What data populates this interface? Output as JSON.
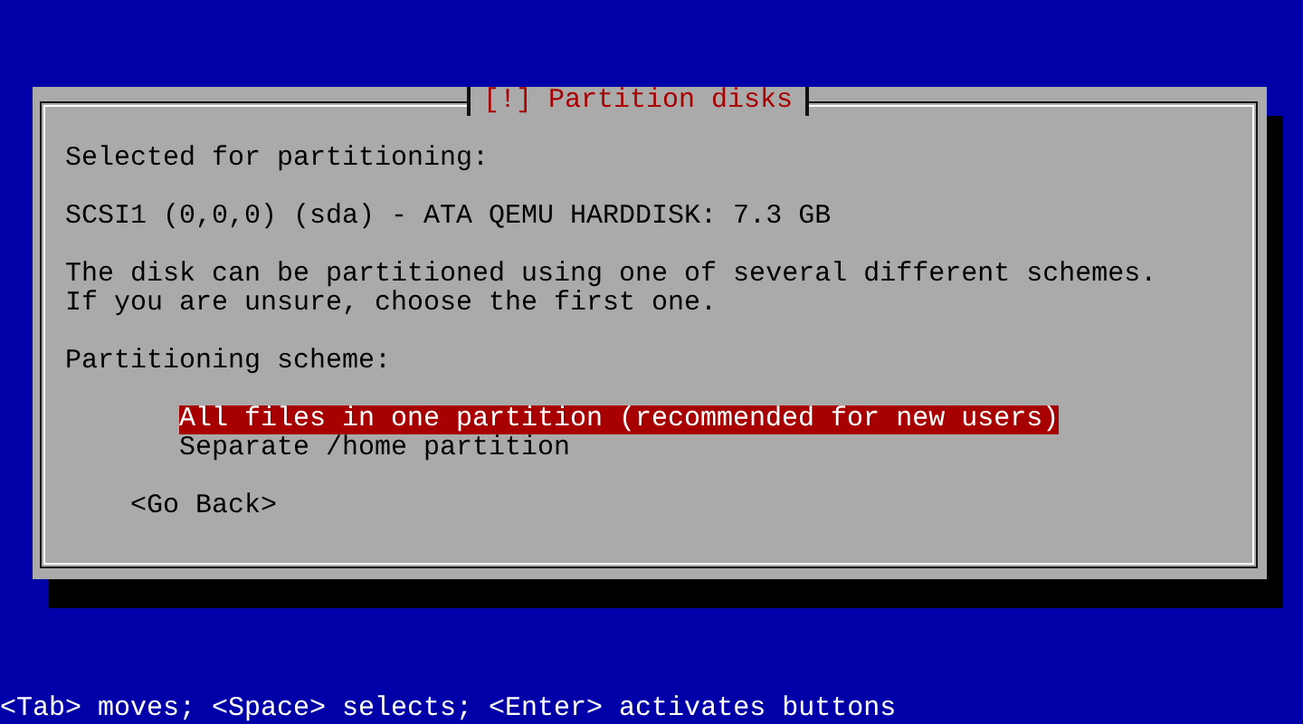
{
  "dialog": {
    "title": "[!] Partition disks",
    "lines": [
      "Selected for partitioning:",
      "SCSI1 (0,0,0) (sda) - ATA QEMU HARDDISK: 7.3 GB",
      "The disk can be partitioned using one of several different schemes.\nIf you are unsure, choose the first one.",
      "Partitioning scheme:"
    ],
    "options": [
      {
        "label": "All files in one partition (recommended for new users)",
        "selected": true
      },
      {
        "label": "Separate /home partition",
        "selected": false
      }
    ],
    "button": "<Go Back>"
  },
  "status_bar": "<Tab> moves; <Space> selects; <Enter> activates buttons"
}
